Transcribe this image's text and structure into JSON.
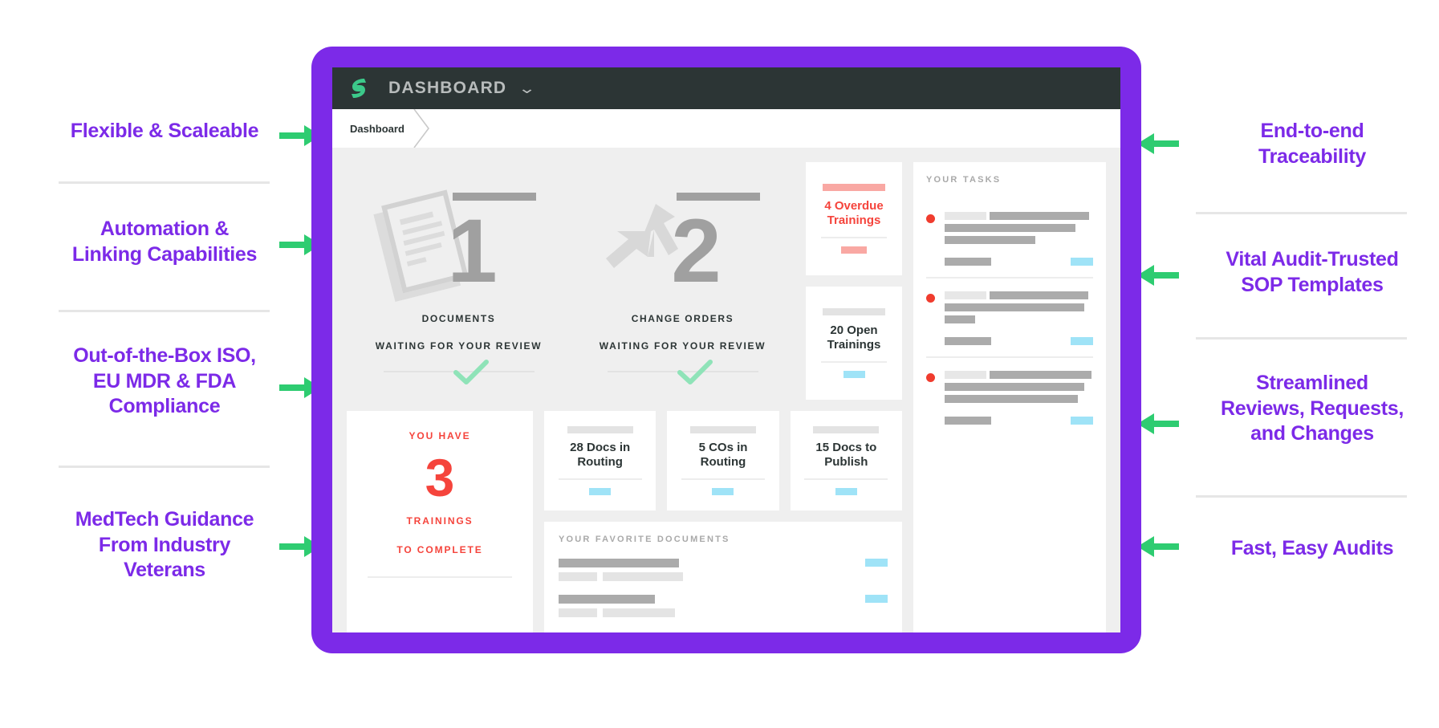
{
  "theme": {
    "brand_purple": "#7c2ae8",
    "arrow_green": "#2ecc71",
    "topbar_dark": "#2c3535",
    "alert_red": "#f5443c",
    "accent_blue": "#9fe3f7",
    "logo_green": "#3cc98a"
  },
  "annotations": {
    "left": [
      {
        "text": "Flexible & Scaleable"
      },
      {
        "text": "Automation &\nLinking Capabilities"
      },
      {
        "text": "Out-of-the-Box ISO,\nEU MDR & FDA\nCompliance"
      },
      {
        "text": "MedTech Guidance\nFrom Industry\nVeterans"
      }
    ],
    "right": [
      {
        "text": "End-to-end\nTraceability"
      },
      {
        "text": "Vital Audit-Trusted\nSOP Templates"
      },
      {
        "text": "Streamlined\nReviews, Requests,\nand Changes"
      },
      {
        "text": "Fast, Easy Audits"
      }
    ]
  },
  "app": {
    "topbar": {
      "title": "DASHBOARD",
      "caret": "chevron-down",
      "logo": "greenlight-guru-logo"
    },
    "breadcrumb": {
      "items": [
        "Dashboard"
      ]
    },
    "metrics": [
      {
        "number": "1",
        "label": "DOCUMENTS",
        "sub": "WAITING FOR YOUR REVIEW",
        "art": "documents-icon"
      },
      {
        "number": "2",
        "label": "CHANGE ORDERS",
        "sub": "WAITING FOR YOUR REVIEW",
        "art": "change-orders-icon"
      }
    ],
    "stat_cards": [
      {
        "title": "4 Overdue\nTrainings",
        "style": "red"
      },
      {
        "title": "20 Open\nTrainings",
        "style": "normal"
      }
    ],
    "training_card": {
      "top_label": "YOU HAVE",
      "count": "3",
      "mid_label": "TRAININGS",
      "bottom_label": "TO COMPLETE"
    },
    "routing_cards": [
      {
        "title": "28 Docs in\nRouting"
      },
      {
        "title": "5 COs in\nRouting"
      },
      {
        "title": "15 Docs to\nPublish"
      }
    ],
    "favorites_panel": {
      "heading": "YOUR FAVORITE DOCUMENTS",
      "row_count": 2
    },
    "tasks_panel": {
      "heading": "YOUR TASKS",
      "item_count": 3
    }
  }
}
